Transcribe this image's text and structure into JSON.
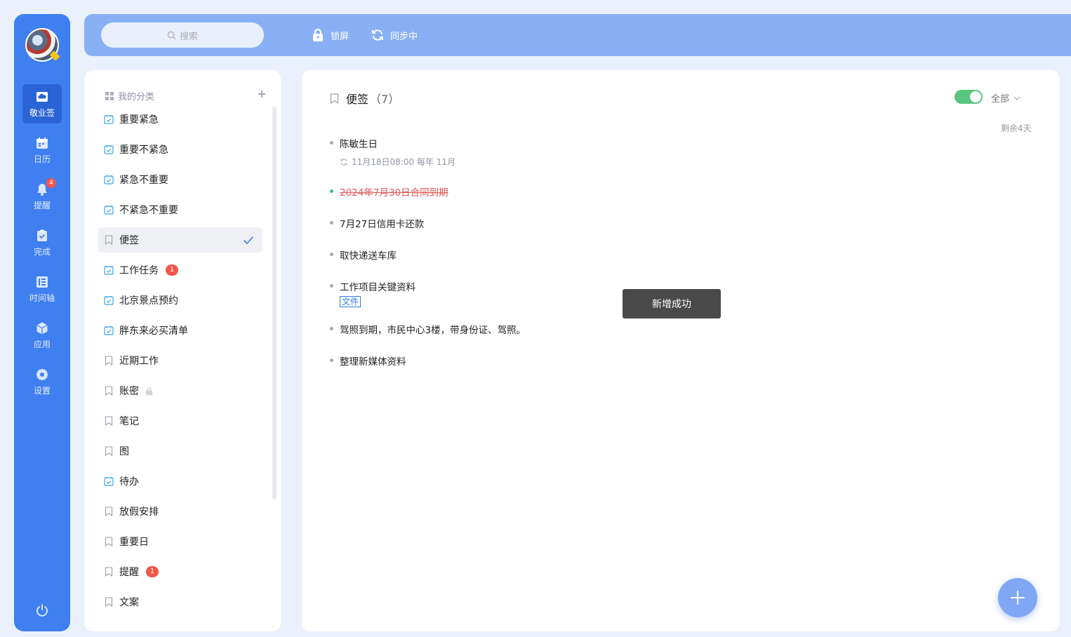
{
  "nav": {
    "items": [
      {
        "label": "敬业签",
        "icon": "cloud-note-icon"
      },
      {
        "label": "日历",
        "icon": "calendar-icon"
      },
      {
        "label": "提醒",
        "icon": "bell-icon",
        "badge": "4"
      },
      {
        "label": "完成",
        "icon": "clipboard-check-icon"
      },
      {
        "label": "时间轴",
        "icon": "timeline-icon"
      },
      {
        "label": "应用",
        "icon": "cube-icon"
      },
      {
        "label": "设置",
        "icon": "gear-icon"
      }
    ]
  },
  "topbar": {
    "search_placeholder": "搜索",
    "lock_label": "锁屏",
    "sync_label": "同步中"
  },
  "categories": {
    "header": "我的分类",
    "items": [
      {
        "label": "重要紧急",
        "icon": "checkbox-icon"
      },
      {
        "label": "重要不紧急",
        "icon": "checkbox-icon"
      },
      {
        "label": "紧急不重要",
        "icon": "checkbox-icon"
      },
      {
        "label": "不紧急不重要",
        "icon": "checkbox-icon"
      },
      {
        "label": "便签",
        "icon": "bookmark-icon",
        "selected": true
      },
      {
        "label": "工作任务",
        "icon": "checkbox-icon",
        "badge": "1"
      },
      {
        "label": "北京景点预约",
        "icon": "checkbox-icon"
      },
      {
        "label": "胖东来必买清单",
        "icon": "checkbox-icon"
      },
      {
        "label": "近期工作",
        "icon": "bookmark-icon"
      },
      {
        "label": "账密",
        "icon": "bookmark-icon",
        "locked": true
      },
      {
        "label": "笔记",
        "icon": "bookmark-icon"
      },
      {
        "label": "图",
        "icon": "bookmark-icon"
      },
      {
        "label": "待办",
        "icon": "checkbox-icon"
      },
      {
        "label": "放假安排",
        "icon": "bookmark-icon"
      },
      {
        "label": "重要日",
        "icon": "bookmark-icon"
      },
      {
        "label": "提醒",
        "icon": "bookmark-icon",
        "badge": "1"
      },
      {
        "label": "文案",
        "icon": "bookmark-icon"
      }
    ]
  },
  "main": {
    "title": "便签",
    "count": "（7）",
    "filter_label": "全部",
    "remaining": "剩余4天",
    "notes": [
      {
        "text": "陈敏生日",
        "sub": "11月18日08:00 每年 11月"
      },
      {
        "text": "2024年7月30日合同到期",
        "done": true
      },
      {
        "text": "7月27日信用卡还款"
      },
      {
        "text": "取快递送车库"
      },
      {
        "text": "工作项目关键资料",
        "tag": "文件"
      },
      {
        "text": "驾照到期，市民中心3楼，带身份证、驾照。"
      },
      {
        "text": "整理新媒体资料"
      }
    ]
  },
  "toast": "新增成功",
  "colors": {
    "nav_bg": "#3f7ff0",
    "topbar_bg": "#89b0f5",
    "accent_green": "#5ac57e",
    "badge_red": "#f2564a",
    "done_red": "#e15b56"
  }
}
